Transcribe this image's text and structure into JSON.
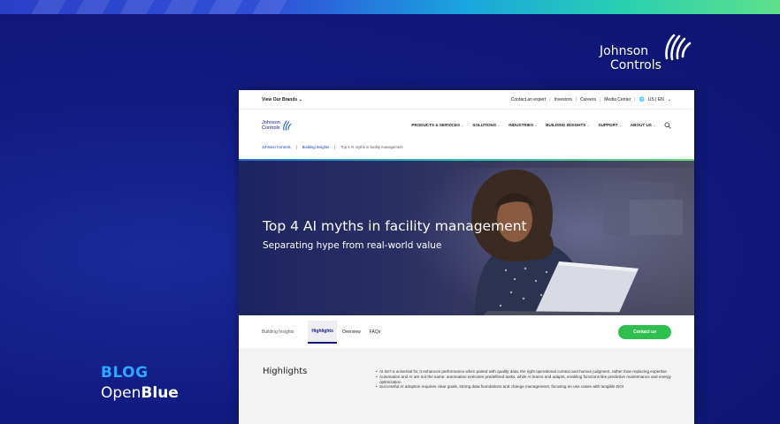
{
  "side_caption": {
    "tag": "BLOG",
    "brand_regular": "Open",
    "brand_bold": "Blue"
  },
  "brand": {
    "line1": "Johnson",
    "line2": "Controls"
  },
  "site": {
    "utility": {
      "brands_label": "View Our Brands",
      "links": [
        "Contact an expert",
        "Investors",
        "Careers",
        "Media Center"
      ],
      "locale": "US | EN"
    },
    "logo": {
      "line1": "Johnson",
      "line2": "Controls"
    },
    "nav": [
      "PRODUCTS & SERVICES",
      "SOLUTIONS",
      "INDUSTRIES",
      "BUILDING INSIGHTS",
      "SUPPORT",
      "ABOUT US"
    ],
    "breadcrumb": [
      "Johnson Controls",
      "Building Insights",
      "Top 4 AI myths in facility management"
    ],
    "hero": {
      "title": "Top 4 AI myths in facility management",
      "subtitle": "Separating hype from real-world value"
    },
    "subnav": {
      "section": "Building Insights",
      "tabs": [
        "Highlights",
        "Overview",
        "FAQs"
      ],
      "active_tab": "Highlights",
      "cta": "Contact us"
    },
    "highlights": {
      "heading": "Highlights",
      "bullets": [
        "AI isn't a universal fix; it enhances performance when paired with quality data, the right operational context and human judgment, rather than replacing expertise",
        "Automation and AI are not the same: automation executes predefined tasks, while AI learns and adapts, enabling functions like predictive maintenance and energy optimization",
        "Successful AI adoption requires clear goals, strong data foundations and change management, focusing on use cases with tangible ROI"
      ]
    }
  },
  "colors": {
    "background": "#12197e",
    "accent_blue": "#2fa6ff",
    "cta_green": "#2fbf4f"
  }
}
